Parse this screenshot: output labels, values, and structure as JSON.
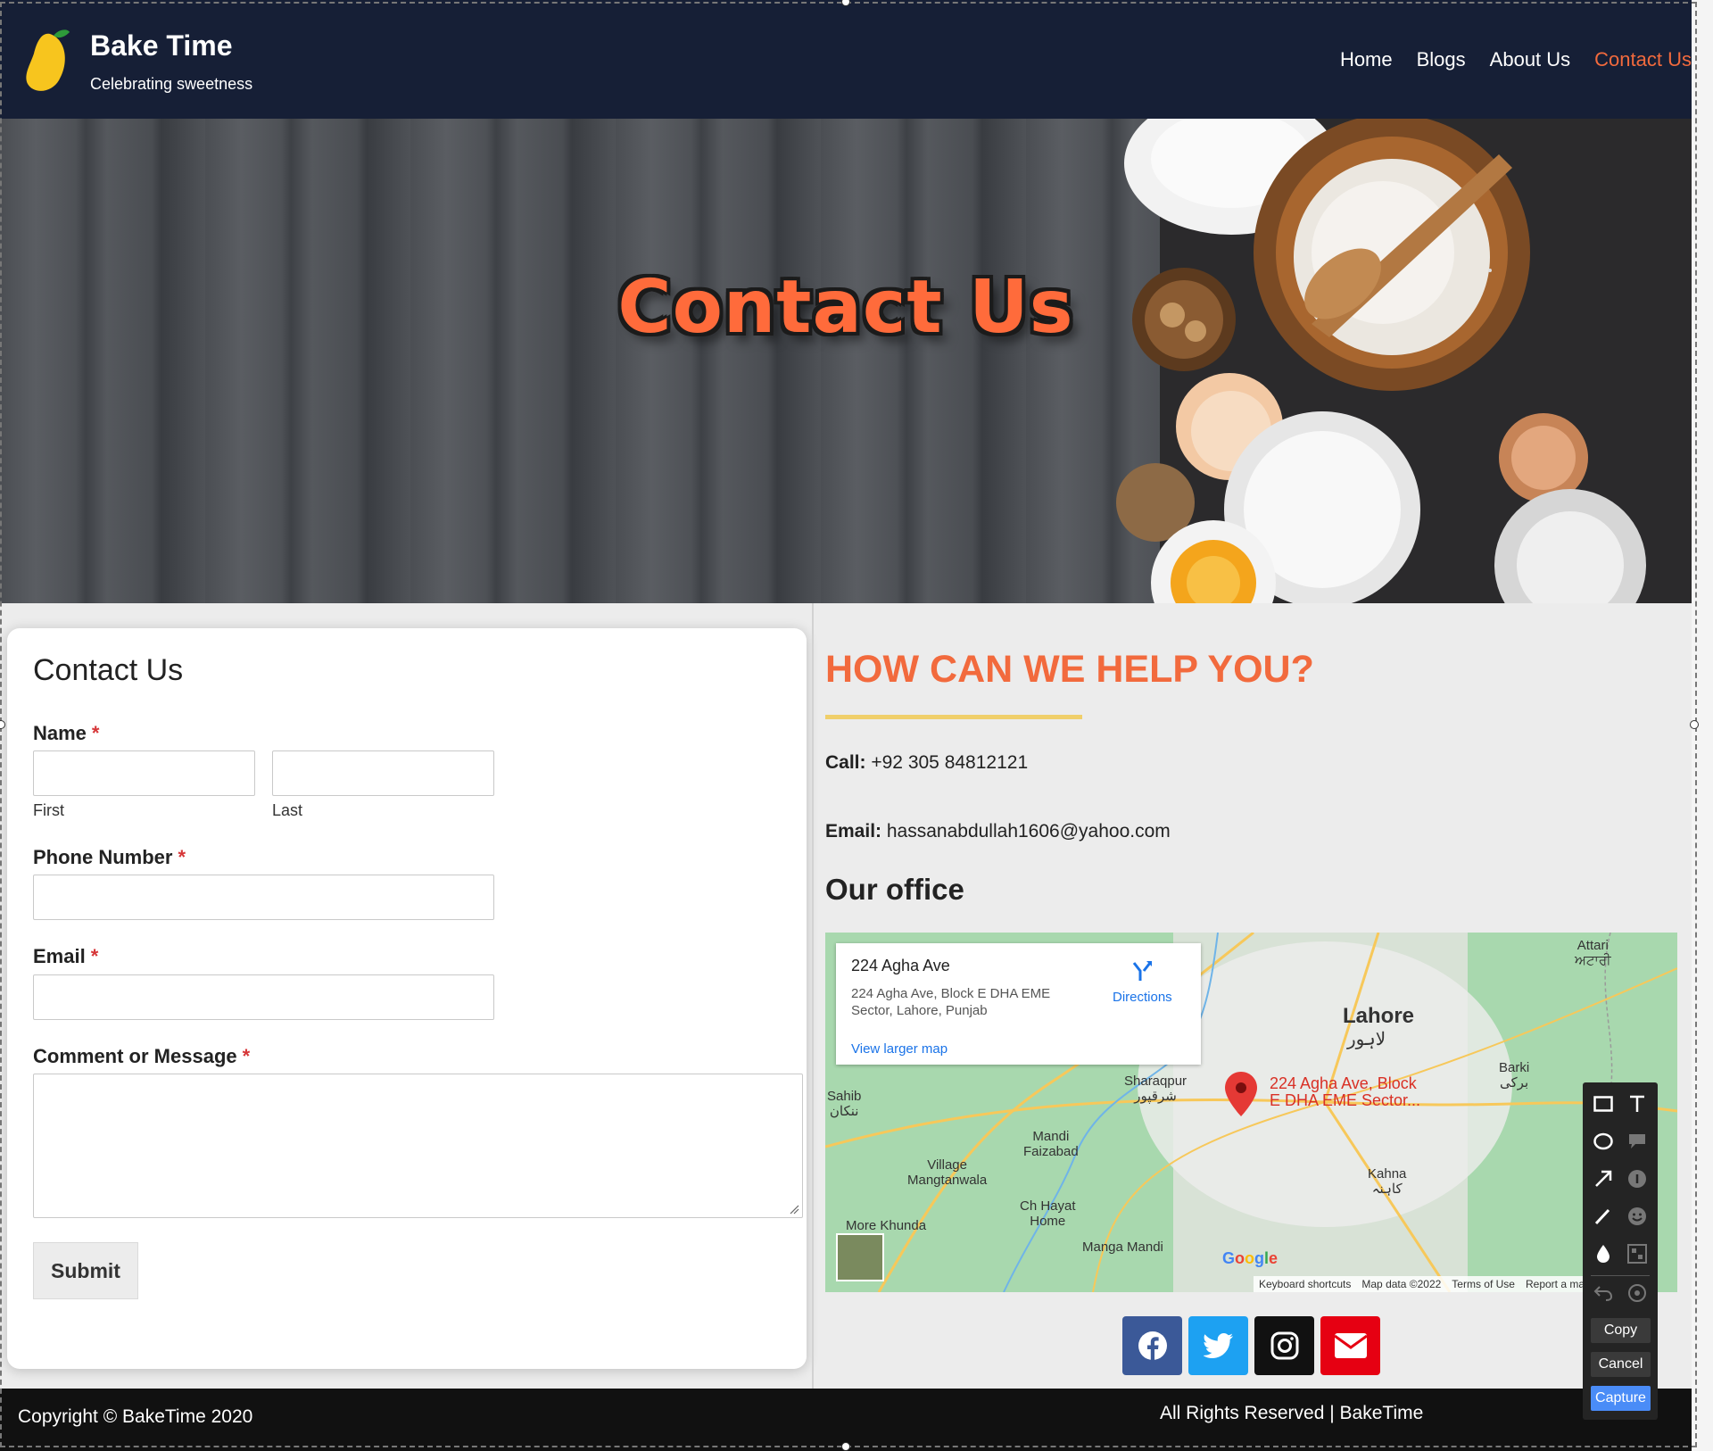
{
  "header": {
    "brand_title": "Bake Time",
    "brand_subtitle": "Celebrating sweetness",
    "nav": [
      {
        "label": "Home",
        "active": false
      },
      {
        "label": "Blogs",
        "active": false
      },
      {
        "label": "About Us",
        "active": false
      },
      {
        "label": "Contact Us",
        "active": true
      }
    ]
  },
  "hero": {
    "title": "Contact Us"
  },
  "form": {
    "title": "Contact Us",
    "name_label": "Name",
    "first_label": "First",
    "last_label": "Last",
    "phone_label": "Phone Number",
    "email_label": "Email",
    "message_label": "Comment or Message",
    "required_mark": "*",
    "submit_label": "Submit"
  },
  "info": {
    "heading": "HOW CAN WE HELP YOU?",
    "call_label": "Call:",
    "call_value": "+92 305 84812121",
    "email_label": "Email:",
    "email_value": "hassanabdullah1606@yahoo.com",
    "office_title": "Our office"
  },
  "map": {
    "place_name": "224 Agha Ave",
    "place_address": "224 Agha Ave, Block E DHA EME Sector, Lahore, Punjab",
    "directions_label": "Directions",
    "larger_map_label": "View larger map",
    "pin_label_1": "224 Agha Ave, Block",
    "pin_label_2": "E DHA EME Sector...",
    "city": "Lahore",
    "city_urdu": "لاہور",
    "places": [
      {
        "name": "Sharaqpur",
        "sub": "شرقپور"
      },
      {
        "name": "Mandi",
        "sub": "Faizabad"
      },
      {
        "name": "Village",
        "sub": "Mangtanwala"
      },
      {
        "name": "Ch Hayat",
        "sub": "Home"
      },
      {
        "name": "More Khunda",
        "sub": ""
      },
      {
        "name": "Manga Mandi",
        "sub": ""
      },
      {
        "name": "Kahna",
        "sub": "کاہنہ"
      },
      {
        "name": "Barki",
        "sub": "برکی"
      },
      {
        "name": "Sahib",
        "sub": "ننکان"
      },
      {
        "name": "Attari",
        "sub": "ਅਟਾਰੀ"
      }
    ],
    "google_label": "Google",
    "footer_links": [
      "Keyboard shortcuts",
      "Map data ©2022",
      "Terms of Use",
      "Report a map error"
    ]
  },
  "social": [
    {
      "name": "facebook",
      "icon": "facebook-icon",
      "color": "#3b5998"
    },
    {
      "name": "twitter",
      "icon": "twitter-icon",
      "color": "#1da1f2"
    },
    {
      "name": "instagram",
      "icon": "instagram-icon",
      "color": "#111111"
    },
    {
      "name": "email",
      "icon": "envelope-icon",
      "color": "#e60012"
    }
  ],
  "footer": {
    "copyright": "Copyright © BakeTime 2020",
    "rights": "All Rights Reserved | BakeTime"
  },
  "capture_tool": {
    "tools": [
      "rectangle-icon",
      "text-icon",
      "ellipse-icon",
      "callout-icon",
      "arrow-icon",
      "step-icon",
      "pen-icon",
      "emoji-icon",
      "blur-icon",
      "mosaic-icon",
      "undo-icon",
      "redo-icon"
    ],
    "copy_label": "Copy",
    "cancel_label": "Cancel",
    "capture_label": "Capture"
  },
  "colors": {
    "header_bg": "#161f36",
    "accent": "#f26a3d",
    "underline": "#f0cf6a",
    "footer_bg": "#111111"
  }
}
